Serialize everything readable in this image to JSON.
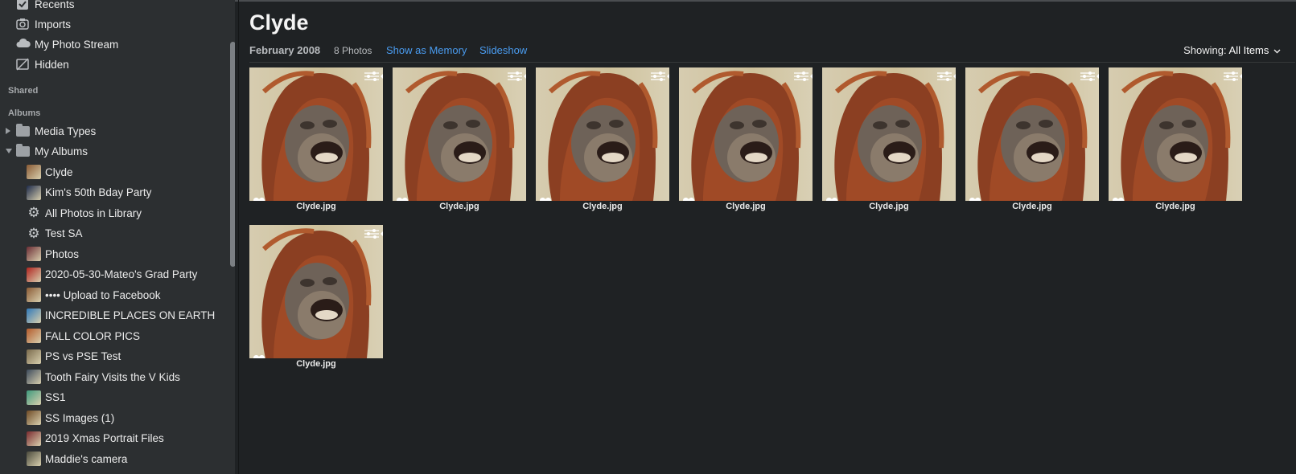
{
  "sidebar": {
    "library": [
      {
        "label": "Recents",
        "icon": "recents-icon"
      },
      {
        "label": "Imports",
        "icon": "imports-icon"
      },
      {
        "label": "My Photo Stream",
        "icon": "cloud-icon"
      },
      {
        "label": "Hidden",
        "icon": "hidden-icon"
      }
    ],
    "shared_header": "Shared",
    "albums_header": "Albums",
    "folders": [
      {
        "label": "Media Types",
        "expanded": false
      },
      {
        "label": "My Albums",
        "expanded": true
      }
    ],
    "albums": [
      {
        "label": "Clyde",
        "icon": "album-thumb-icon",
        "color": "#8a5a34"
      },
      {
        "label": "Kim's 50th Bday Party",
        "icon": "album-thumb-icon",
        "color": "#1d2a4a"
      },
      {
        "label": "All Photos in Library",
        "icon": "smart-album-gear-icon"
      },
      {
        "label": "Test SA",
        "icon": "smart-album-gear-icon"
      },
      {
        "label": "Photos",
        "icon": "album-thumb-icon",
        "color": "#6b2c34"
      },
      {
        "label": "2020-05-30-Mateo's Grad Party",
        "icon": "album-thumb-icon",
        "color": "#b0241e"
      },
      {
        "label": "•••• Upload to Facebook",
        "icon": "album-thumb-icon",
        "color": "#8a5a34"
      },
      {
        "label": "INCREDIBLE PLACES ON EARTH",
        "icon": "album-thumb-icon",
        "color": "#2f78b8"
      },
      {
        "label": "FALL COLOR PICS",
        "icon": "album-thumb-icon",
        "color": "#b45a2a"
      },
      {
        "label": "PS vs PSE Test",
        "icon": "album-thumb-icon",
        "color": "#7a6a4c"
      },
      {
        "label": "Tooth Fairy Visits the V Kids",
        "icon": "album-thumb-icon",
        "color": "#3c4a5c"
      },
      {
        "label": "SS1",
        "icon": "album-thumb-icon",
        "color": "#3e9a7c"
      },
      {
        "label": "SS Images (1)",
        "icon": "album-thumb-icon",
        "color": "#6e4a24"
      },
      {
        "label": "2019 Xmas Portrait Files",
        "icon": "album-thumb-icon",
        "color": "#7a2a2e"
      },
      {
        "label": "Maddie's camera",
        "icon": "album-thumb-icon",
        "color": "#4a4a3c"
      }
    ]
  },
  "main": {
    "title": "Clyde",
    "date": "February 2008",
    "count": "8 Photos",
    "show_memory": "Show as Memory",
    "slideshow": "Slideshow",
    "showing_label": "Showing:",
    "showing_value": "All Items",
    "photos": [
      {
        "filename": "Clyde.jpg",
        "favorite": true
      },
      {
        "filename": "Clyde.jpg",
        "favorite": true
      },
      {
        "filename": "Clyde.jpg",
        "favorite": true
      },
      {
        "filename": "Clyde.jpg",
        "favorite": true
      },
      {
        "filename": "Clyde.jpg",
        "favorite": true
      },
      {
        "filename": "Clyde.jpg",
        "favorite": true
      },
      {
        "filename": "Clyde.jpg",
        "favorite": true
      },
      {
        "filename": "Clyde.jpg",
        "favorite": true
      }
    ]
  }
}
